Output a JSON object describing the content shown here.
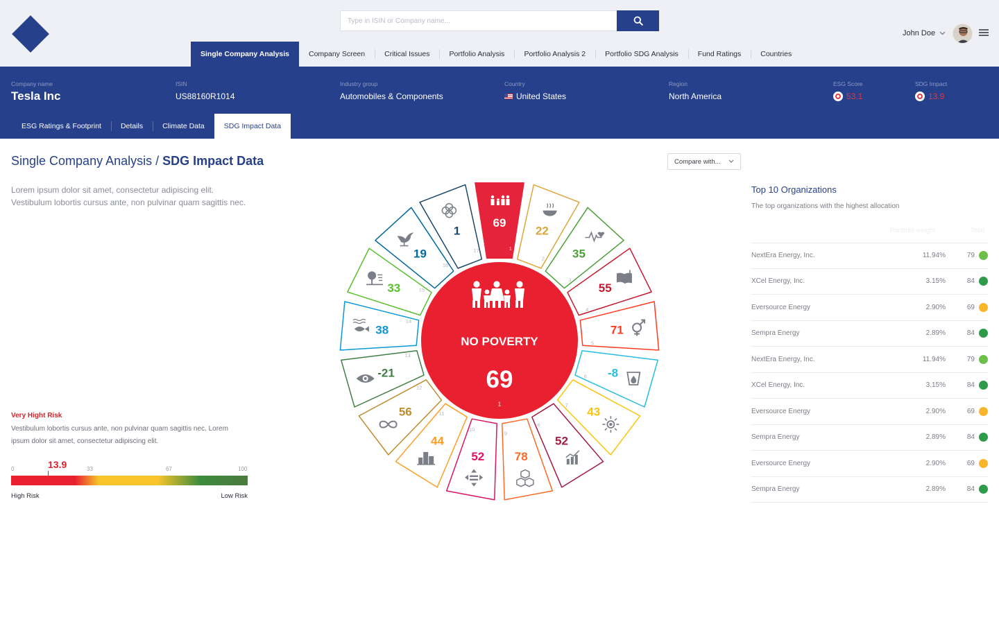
{
  "search": {
    "placeholder": "Type in ISIN or Company name..."
  },
  "user": {
    "name": "John Doe"
  },
  "nav": {
    "tabs": [
      {
        "label": "Single Company Analysis"
      },
      {
        "label": "Company Screen"
      },
      {
        "label": "Critical Issues"
      },
      {
        "label": "Portfolio Analysis"
      },
      {
        "label": "Portfolio Analysis 2"
      },
      {
        "label": "Portfolio SDG Analysis"
      },
      {
        "label": "Fund Ratings"
      },
      {
        "label": "Countries"
      }
    ]
  },
  "company": {
    "name_label": "Company name",
    "name": "Tesla Inc",
    "isin_label": "ISIN",
    "isin": "US88160R1014",
    "industry_label": "Industry group",
    "industry": "Automobiles & Components",
    "country_label": "Country",
    "country": "United States",
    "region_label": "Region",
    "region": "North America",
    "esg_label": "ESG Score",
    "esg": "53.1",
    "sdg_label": "SDG Impact",
    "sdg": "13.9"
  },
  "subtabs": [
    {
      "label": "ESG Ratings & Footprint"
    },
    {
      "label": "Details"
    },
    {
      "label": "Climate Data"
    },
    {
      "label": "SDG Impact Data"
    }
  ],
  "breadcrumb": {
    "parent": "Single Company Analysis",
    "separator": " / ",
    "current": "SDG Impact Data"
  },
  "intro": "Lorem ipsum dolor sit amet, consectetur adipiscing elit. Vestibulum lobortis cursus ante, non pulvinar quam sagittis nec.",
  "risk": {
    "title": "Very Hight Risk",
    "description": "Vestibulum lobortis cursus ante, non pulvinar quam sagittis nec. Lorem ipsum dolor sit amet, consectetur adipiscing elit.",
    "value": "13.9",
    "ticks": [
      "0",
      "33",
      "67",
      "100"
    ],
    "high_label": "High Risk",
    "low_label": "Low Risk"
  },
  "wheel": {
    "center_title": "NO POVERTY",
    "center_value": "69",
    "center_index": "1",
    "colors": {
      "red": "#e8202f"
    },
    "segments": [
      {
        "n": "1",
        "value": "69",
        "color": "#e5243b",
        "icon": "family-icon",
        "filled": true
      },
      {
        "n": "2",
        "value": "22",
        "color": "#dda63a",
        "icon": "bowl-icon"
      },
      {
        "n": "3",
        "value": "35",
        "color": "#4c9f38",
        "icon": "heartbeat-icon"
      },
      {
        "n": "4",
        "value": "55",
        "color": "#c5192d",
        "icon": "book-icon"
      },
      {
        "n": "5",
        "value": "71",
        "color": "#ff3a21",
        "icon": "gender-icon"
      },
      {
        "n": "6",
        "value": "-8",
        "color": "#26bde2",
        "icon": "water-icon"
      },
      {
        "n": "7",
        "value": "43",
        "color": "#fcc30b",
        "icon": "sun-icon"
      },
      {
        "n": "8",
        "value": "52",
        "color": "#a21942",
        "icon": "growth-chart-icon"
      },
      {
        "n": "9",
        "value": "78",
        "color": "#fd6925",
        "icon": "cubes-icon"
      },
      {
        "n": "10",
        "value": "52",
        "color": "#dd1367",
        "icon": "equality-icon"
      },
      {
        "n": "11",
        "value": "44",
        "color": "#fd9d24",
        "icon": "city-icon"
      },
      {
        "n": "12",
        "value": "56",
        "color": "#bf8b2e",
        "icon": "infinity-icon"
      },
      {
        "n": "13",
        "value": "-21",
        "color": "#3f7e44",
        "icon": "eye-icon"
      },
      {
        "n": "14",
        "value": "38",
        "color": "#0a97d9",
        "icon": "fish-icon"
      },
      {
        "n": "15",
        "value": "33",
        "color": "#56c02b",
        "icon": "tree-icon"
      },
      {
        "n": "16",
        "value": "19",
        "color": "#00689d",
        "icon": "dove-icon"
      },
      {
        "n": "17",
        "value": "1",
        "color": "#19486a",
        "icon": "flower-icon"
      }
    ]
  },
  "compare": {
    "label": "Compare with..."
  },
  "top": {
    "title": "Top 10 Organizations",
    "subtitle": "The top organizations with the highest allocation",
    "col_weight": "Portfolio weight",
    "col_total": "Total",
    "colors": {
      "green_light": "#6cc04a",
      "green": "#2e9b4a",
      "yellow": "#f9b62a"
    },
    "rows": [
      {
        "name": "NextEra Energy, Inc.",
        "weight": "11.94%",
        "total": "79",
        "color": "#6cc04a"
      },
      {
        "name": "XCel Energy, Inc.",
        "weight": "3.15%",
        "total": "84",
        "color": "#2e9b4a"
      },
      {
        "name": "Eversource Energy",
        "weight": "2.90%",
        "total": "69",
        "color": "#f9b62a"
      },
      {
        "name": "Sempra Energy",
        "weight": "2.89%",
        "total": "84",
        "color": "#2e9b4a"
      },
      {
        "name": "NextEra Energy, Inc.",
        "weight": "11.94%",
        "total": "79",
        "color": "#6cc04a"
      },
      {
        "name": "XCel Energy, Inc.",
        "weight": "3.15%",
        "total": "84",
        "color": "#2e9b4a"
      },
      {
        "name": "Eversource Energy",
        "weight": "2.90%",
        "total": "69",
        "color": "#f9b62a"
      },
      {
        "name": "Sempra Energy",
        "weight": "2.89%",
        "total": "84",
        "color": "#2e9b4a"
      },
      {
        "name": "Eversource Energy",
        "weight": "2.90%",
        "total": "69",
        "color": "#f9b62a"
      },
      {
        "name": "Sempra Energy",
        "weight": "2.89%",
        "total": "84",
        "color": "#2e9b4a"
      }
    ]
  }
}
